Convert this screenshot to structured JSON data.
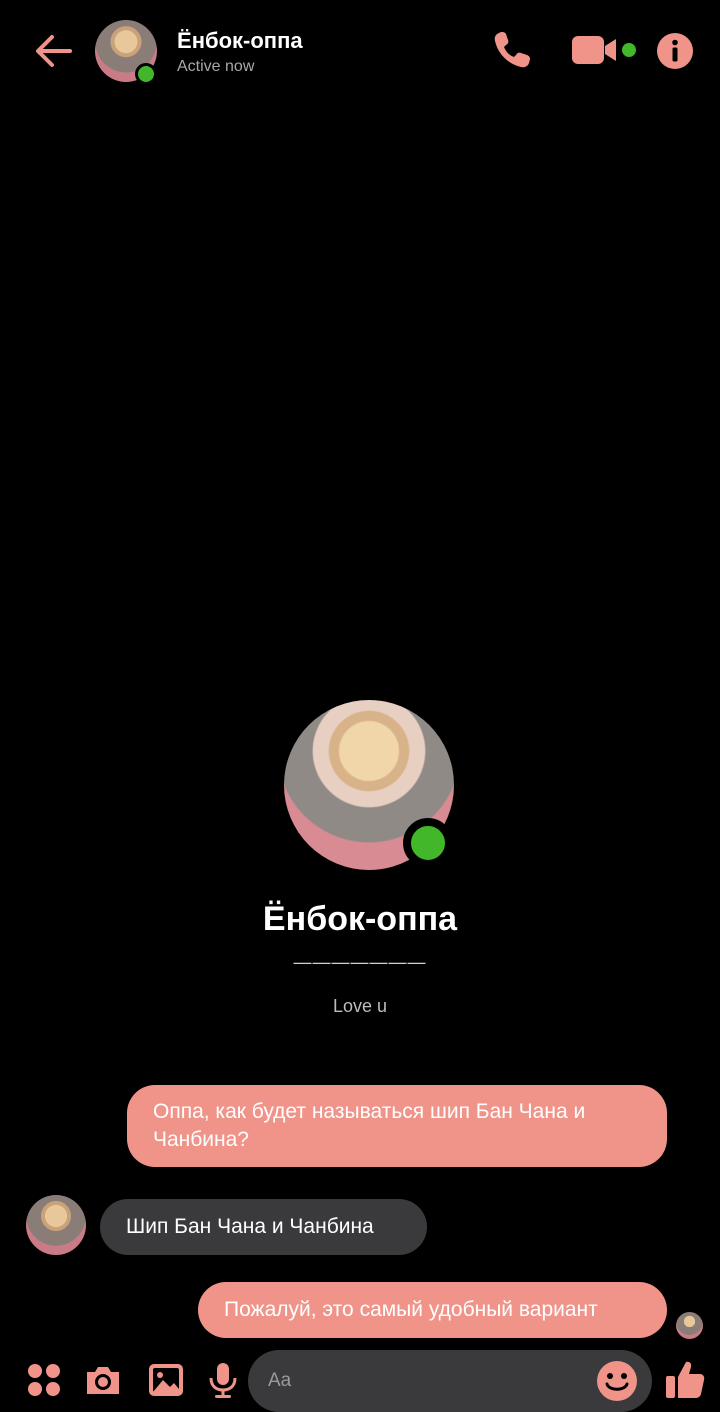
{
  "accent": "#f0948a",
  "online": "#42b72a",
  "header": {
    "name": "Ёнбок-оппа",
    "status": "Active now",
    "icons": [
      "back-arrow-icon",
      "phone-icon",
      "video-camera-icon",
      "info-icon"
    ]
  },
  "profile": {
    "name": "Ёнбок-оппа",
    "line": "———————",
    "bio": "Love u"
  },
  "messages": [
    {
      "from": "me",
      "text": "Оппа, как будет называться шип Бан Чана и Чанбина?"
    },
    {
      "from": "contact",
      "text": "Шип Бан Чана и Чанбина"
    },
    {
      "from": "me",
      "text": "Пожалуй, это самый удобный вариант"
    }
  ],
  "composer": {
    "placeholder": "Aa",
    "icons": [
      "apps-menu-icon",
      "camera-icon",
      "gallery-icon",
      "microphone-icon",
      "emoji-icon",
      "thumbs-up-icon"
    ]
  }
}
